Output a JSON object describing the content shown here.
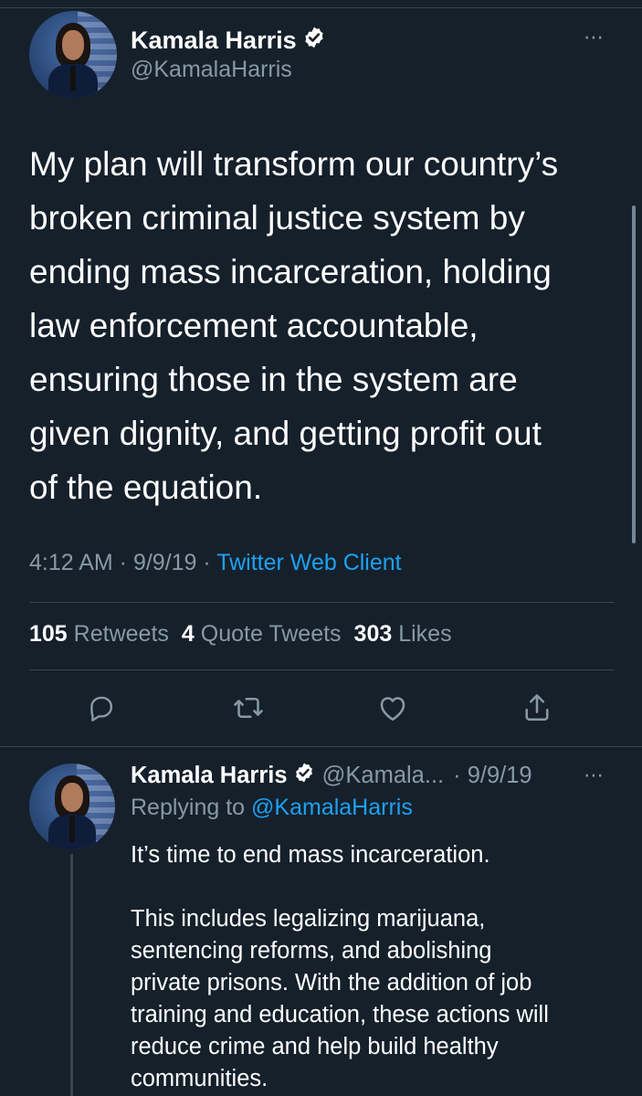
{
  "main_tweet": {
    "author_name": "Kamala Harris",
    "author_handle": "@KamalaHarris",
    "text_lines": [
      "My plan will transform our country’s",
      "broken criminal justice system by",
      "ending mass incarceration, holding",
      "law enforcement accountable,",
      "ensuring those in the system are",
      "given dignity, and getting profit out",
      "of the equation."
    ],
    "time": "4:12 AM",
    "date": "9/9/19",
    "separator": " · ",
    "client": "Twitter Web Client",
    "stats": {
      "retweets_count": "105",
      "retweets_label": "Retweets",
      "quotes_count": "4",
      "quotes_label": "Quote Tweets",
      "likes_count": "303",
      "likes_label": "Likes"
    },
    "more_icon": "⋯"
  },
  "reply_tweet": {
    "author_name": "Kamala Harris",
    "author_handle_truncated": "@Kamala...",
    "date": "· 9/9/19",
    "more_icon": "⋯",
    "replying_prefix": "Replying to ",
    "replying_mention": "@KamalaHarris",
    "paragraph1": "It’s time to end mass incarceration.",
    "paragraph2_lines": [
      "This includes legalizing marijuana,",
      "sentencing reforms, and abolishing",
      "private prisons. With the addition of job",
      "training and education, these actions will",
      "reduce crime and help build healthy",
      "communities."
    ]
  },
  "icons": {
    "reply": "reply-icon",
    "retweet": "retweet-icon",
    "like": "like-icon",
    "share": "share-icon",
    "verified": "verified-badge-icon"
  },
  "colors": {
    "background": "#15202b",
    "text": "#ffffff",
    "secondary": "#8899a6",
    "accent": "#1da1f2",
    "divider": "#38444d"
  }
}
